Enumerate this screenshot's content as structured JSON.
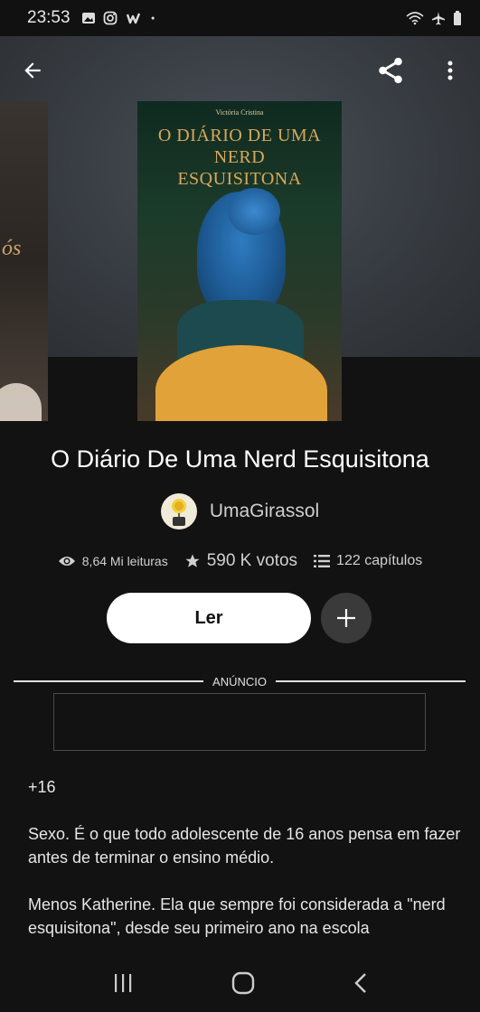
{
  "status_bar": {
    "time": "23:53",
    "icons_left": [
      "gallery-icon",
      "instagram-icon",
      "wattpad-icon",
      "dot-icon"
    ],
    "icons_right": [
      "wifi-icon",
      "airplane-icon",
      "battery-icon"
    ]
  },
  "top_bar": {
    "back_icon": "arrow-left-icon",
    "share_icon": "share-icon",
    "more_icon": "more-vertical-icon"
  },
  "cover": {
    "author": "Victória Cristina",
    "title_line1": "O DIÁRIO DE UMA NERD",
    "title_line2": "ESQUISITONA",
    "left_cover_text": "ós"
  },
  "story": {
    "title": "O Diário De Uma Nerd Esquisitona",
    "author_name": "UmaGirassol"
  },
  "stats": {
    "reads": "8,64 Mi leituras",
    "votes": "590 K votos",
    "chapters": "122 capítulos"
  },
  "actions": {
    "read_label": "Ler"
  },
  "ad": {
    "label": "ANÚNCIO"
  },
  "description": {
    "p1": "+16",
    "p2": "Sexo. É o que todo adolescente de 16 anos pensa em fazer antes de terminar o ensino médio.",
    "p3": "Menos Katherine. Ela que sempre foi considerada a \"nerd esquisitona\", desde seu primeiro ano na escola"
  },
  "colors": {
    "background": "#121212",
    "button_bg": "#ffffff",
    "cover_title": "#d9a85a"
  }
}
